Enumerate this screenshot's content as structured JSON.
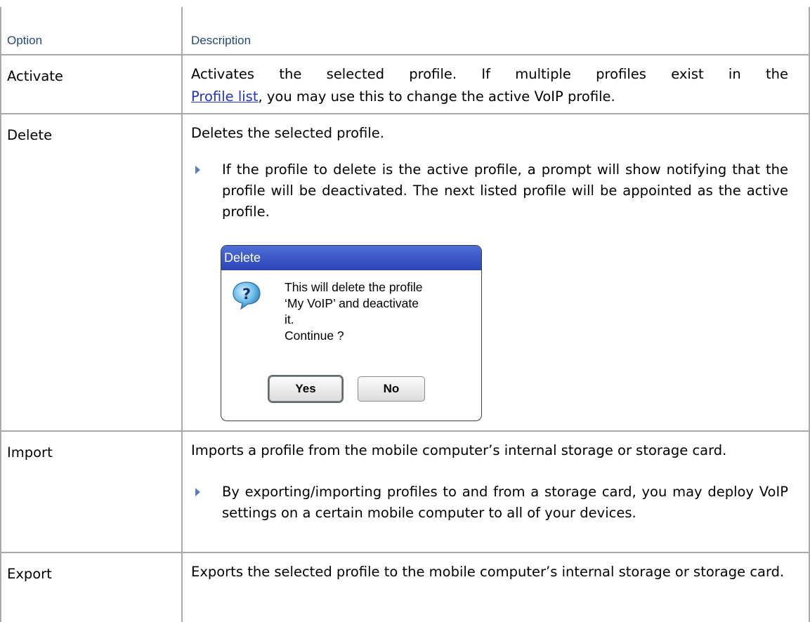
{
  "table": {
    "headers": {
      "option": "Option",
      "description": "Description"
    },
    "rows": [
      {
        "option": "Activate",
        "desc_before_link": "Activates the selected profile. If multiple profiles exist in the",
        "link_text": "Profile list",
        "desc_after_link": ", you may use this to change the active VoIP profile."
      },
      {
        "option": "Delete",
        "description": "Deletes the selected profile.",
        "bullet": "If the profile to delete is the active profile, a prompt will show notifying that the profile will be deactivated. The next listed profile will be appointed as the active profile."
      },
      {
        "option": "Import",
        "description": "Imports a profile from the mobile computer’s internal storage or storage card.",
        "bullet": "By exporting/importing profiles to and from a storage card, you may deploy VoIP settings on a certain mobile computer to all of your devices."
      },
      {
        "option": "Export",
        "description": "Exports the selected profile to the mobile computer’s internal storage or storage card."
      }
    ]
  },
  "dialog": {
    "title": "Delete",
    "message": "This will delete the profile\n‘My VoIP’ and deactivate\nit.\nContinue ?",
    "yes_label": "Yes",
    "no_label": "No",
    "icon": "question-icon"
  },
  "colors": {
    "header_text": "#1f4a78",
    "grid_line": "#a9a9a9",
    "dialog_title_bar": "#3452c4",
    "link": "#1f34c8"
  }
}
